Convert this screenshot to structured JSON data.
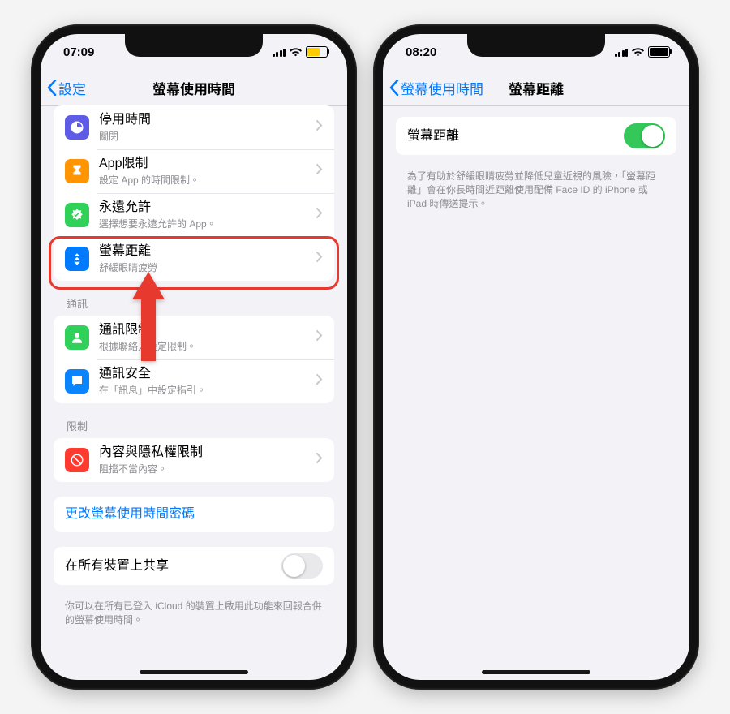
{
  "phone_left": {
    "status": {
      "time": "07:09"
    },
    "nav": {
      "back": "設定",
      "title": "螢幕使用時間"
    },
    "g1": {
      "downtime": {
        "title": "停用時間",
        "sub": "關閉"
      },
      "applimit": {
        "title": "App限制",
        "sub": "設定 App 的時間限制。"
      },
      "always": {
        "title": "永遠允許",
        "sub": "選擇想要永遠允許的 App。"
      },
      "distance": {
        "title": "螢幕距離",
        "sub": "舒緩眼睛疲勞"
      }
    },
    "sec_comm_label": "通訊",
    "g2": {
      "commlimit": {
        "title": "通訊限制",
        "sub": "根據聯絡人設定限制。"
      },
      "commsafe": {
        "title": "通訊安全",
        "sub": "在「訊息」中設定指引。"
      }
    },
    "sec_restrict_label": "限制",
    "g3": {
      "content": {
        "title": "內容與隱私權限制",
        "sub": "阻擋不當內容。"
      }
    },
    "g4": {
      "passcode": "更改螢幕使用時間密碼"
    },
    "g5": {
      "share": "在所有裝置上共享"
    },
    "share_footer": "你可以在所有已登入 iCloud 的裝置上啟用此功能來回報合併的螢幕使用時間。"
  },
  "phone_right": {
    "status": {
      "time": "08:20"
    },
    "nav": {
      "back": "螢幕使用時間",
      "title": "螢幕距離"
    },
    "row": {
      "title": "螢幕距離"
    },
    "footer": "為了有助於舒緩眼睛疲勞並降低兒童近視的風險，「螢幕距離」會在你長時間近距離使用配備 Face ID 的 iPhone 或 iPad 時傳送提示。"
  },
  "colors": {
    "downtime": "#5e5ce6",
    "applimit": "#ff9500",
    "always": "#30d158",
    "distance": "#007aff",
    "commlimit": "#30d158",
    "commsafe": "#0a84ff",
    "content": "#ff3b30"
  }
}
